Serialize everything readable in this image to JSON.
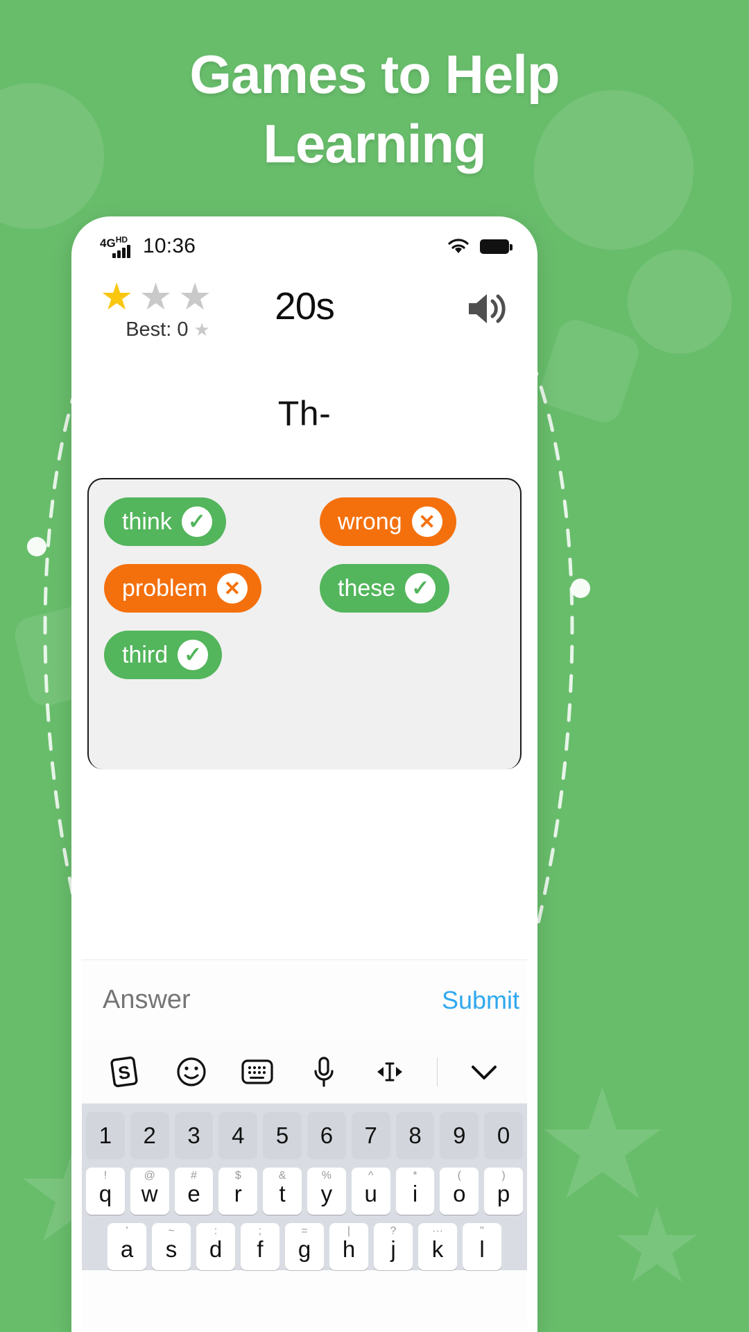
{
  "theme": {
    "background": "#68bd6b",
    "accent_correct": "#53b55c",
    "accent_wrong": "#f4700d",
    "star_active": "#fac710",
    "star_inactive": "#c9c9c9",
    "submit_color": "#2fa8ef"
  },
  "headline": {
    "line1": "Games to Help",
    "line2": "Learning"
  },
  "status_bar": {
    "network": "4G",
    "network_sup": "HD",
    "time": "10:36",
    "wifi_icon": "wifi-icon",
    "battery_icon": "battery-icon"
  },
  "game": {
    "stars": [
      {
        "state": "on",
        "glyph": "★"
      },
      {
        "state": "off",
        "glyph": "★"
      },
      {
        "state": "off",
        "glyph": "★"
      }
    ],
    "best_label": "Best: 0",
    "best_star": "★",
    "timer": "20s",
    "speaker_icon": "speaker-icon",
    "prompt": "Th-",
    "answers": [
      {
        "word": "think",
        "status": "correct",
        "mark": "✓"
      },
      {
        "word": "wrong",
        "status": "wrong",
        "mark": "✕"
      },
      {
        "word": "problem",
        "status": "wrong",
        "mark": "✕"
      },
      {
        "word": "these",
        "status": "correct",
        "mark": "✓"
      },
      {
        "word": "third",
        "status": "correct",
        "mark": "✓"
      }
    ]
  },
  "answer_bar": {
    "placeholder": "Answer",
    "value": "",
    "submit_label": "Submit"
  },
  "keyboard": {
    "toolbar": [
      "sogou-logo-icon",
      "emoji-icon",
      "keyboard-icon",
      "microphone-icon",
      "cursor-move-icon",
      "collapse-keyboard-icon"
    ],
    "row_numbers": [
      "1",
      "2",
      "3",
      "4",
      "5",
      "6",
      "7",
      "8",
      "9",
      "0"
    ],
    "row_q": [
      {
        "main": "q",
        "sub": "!"
      },
      {
        "main": "w",
        "sub": "@"
      },
      {
        "main": "e",
        "sub": "#"
      },
      {
        "main": "r",
        "sub": "$"
      },
      {
        "main": "t",
        "sub": "&"
      },
      {
        "main": "y",
        "sub": "%"
      },
      {
        "main": "u",
        "sub": "^"
      },
      {
        "main": "i",
        "sub": "*"
      },
      {
        "main": "o",
        "sub": "("
      },
      {
        "main": "p",
        "sub": ")"
      }
    ],
    "row_a": [
      {
        "main": "a",
        "sub": "'"
      },
      {
        "main": "s",
        "sub": "~"
      },
      {
        "main": "d",
        "sub": ":"
      },
      {
        "main": "f",
        "sub": ";"
      },
      {
        "main": "g",
        "sub": "="
      },
      {
        "main": "h",
        "sub": "|"
      },
      {
        "main": "j",
        "sub": "?"
      },
      {
        "main": "k",
        "sub": "···"
      },
      {
        "main": "l",
        "sub": "\""
      }
    ]
  }
}
